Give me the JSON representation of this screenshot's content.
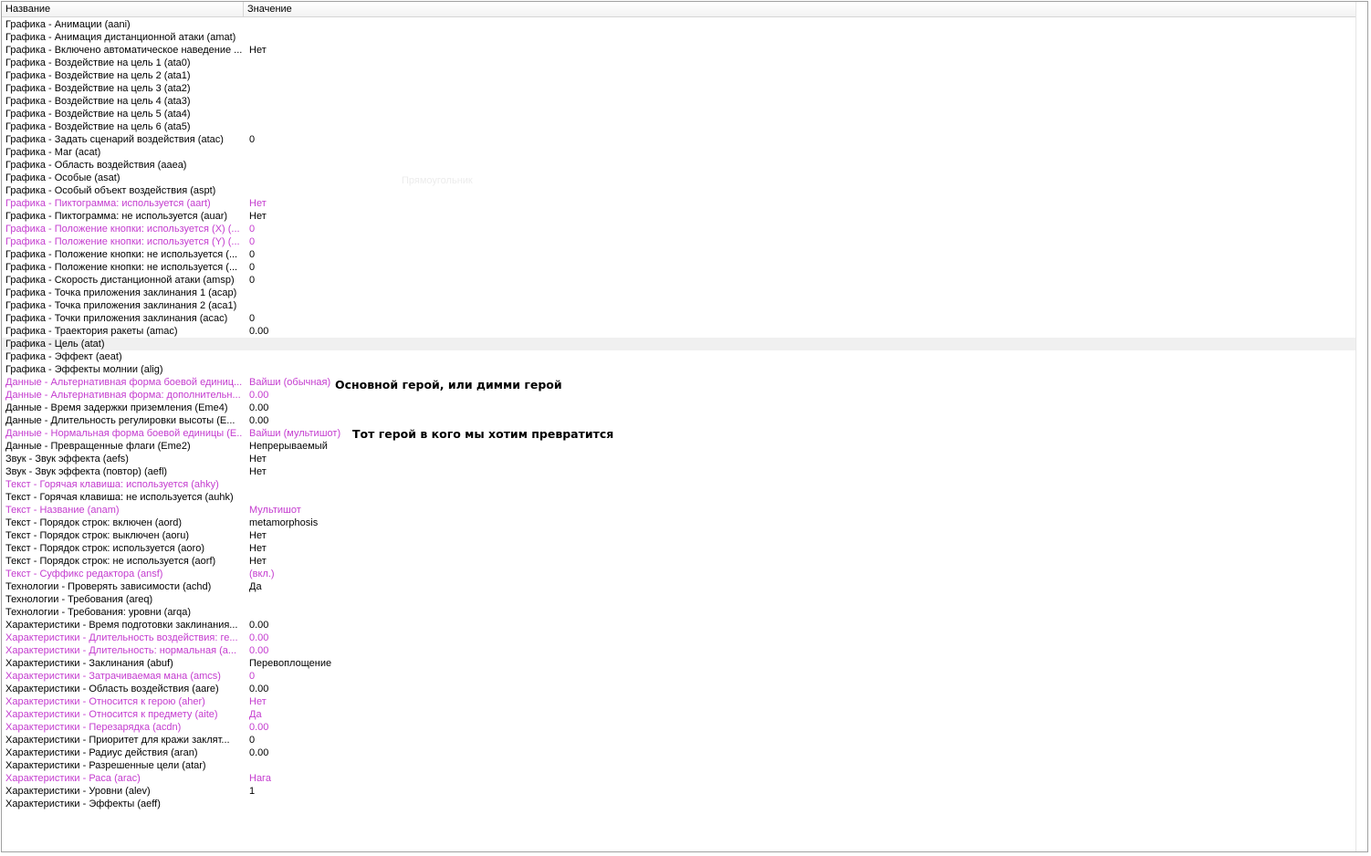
{
  "columns": {
    "name": "Название",
    "value": "Значение"
  },
  "rows": [
    {
      "name": "Графика - Анимации (aani)",
      "value": "",
      "modified": false
    },
    {
      "name": "Графика - Анимация дистанционной атаки (amat)",
      "value": "",
      "modified": false
    },
    {
      "name": "Графика - Включено автоматическое наведение ...",
      "value": "Нет",
      "modified": false
    },
    {
      "name": "Графика - Воздействие на цель 1 (ata0)",
      "value": "",
      "modified": false
    },
    {
      "name": "Графика - Воздействие на цель 2 (ata1)",
      "value": "",
      "modified": false
    },
    {
      "name": "Графика - Воздействие на цель 3 (ata2)",
      "value": "",
      "modified": false
    },
    {
      "name": "Графика - Воздействие на цель 4 (ata3)",
      "value": "",
      "modified": false
    },
    {
      "name": "Графика - Воздействие на цель 5 (ata4)",
      "value": "",
      "modified": false
    },
    {
      "name": "Графика - Воздействие на цель 6 (ata5)",
      "value": "",
      "modified": false
    },
    {
      "name": "Графика - Задать сценарий воздействия (atac)",
      "value": "0",
      "modified": false
    },
    {
      "name": "Графика - Маг (acat)",
      "value": "",
      "modified": false
    },
    {
      "name": "Графика - Область воздействия (aaea)",
      "value": "",
      "modified": false
    },
    {
      "name": "Графика - Особые (asat)",
      "value": "",
      "modified": false
    },
    {
      "name": "Графика - Особый объект воздействия (aspt)",
      "value": "",
      "modified": false
    },
    {
      "name": "Графика - Пиктограмма: используется (aart)",
      "value": "Нет",
      "modified": true
    },
    {
      "name": "Графика - Пиктограмма: не используется (auar)",
      "value": "Нет",
      "modified": false
    },
    {
      "name": "Графика - Положение кнопки: используется (X) (...",
      "value": "0",
      "modified": true
    },
    {
      "name": "Графика - Положение кнопки: используется (Y) (...",
      "value": "0",
      "modified": true
    },
    {
      "name": "Графика - Положение кнопки: не используется (...",
      "value": "0",
      "modified": false
    },
    {
      "name": "Графика - Положение кнопки: не используется (...",
      "value": "0",
      "modified": false
    },
    {
      "name": "Графика - Скорость дистанционной атаки (amsp)",
      "value": "0",
      "modified": false
    },
    {
      "name": "Графика - Точка приложения заклинания 1 (acap)",
      "value": "",
      "modified": false
    },
    {
      "name": "Графика - Точка приложения заклинания 2 (aca1)",
      "value": "",
      "modified": false
    },
    {
      "name": "Графика - Точки приложения заклинания (acac)",
      "value": "0",
      "modified": false
    },
    {
      "name": "Графика - Траектория ракеты (amac)",
      "value": "0.00",
      "modified": false
    },
    {
      "name": "Графика - Цель (atat)",
      "value": "",
      "modified": false
    },
    {
      "name": "Графика - Эффект (aeat)",
      "value": "",
      "modified": false
    },
    {
      "name": "Графика - Эффекты молнии (alig)",
      "value": "",
      "modified": false
    },
    {
      "name": "Данные - Альтернативная форма боевой единиц...",
      "value": "Вайши (обычная)",
      "modified": true
    },
    {
      "name": "Данные - Альтернативная форма: дополнительн...",
      "value": "0.00",
      "modified": true
    },
    {
      "name": "Данные - Время задержки приземления (Eme4)",
      "value": "0.00",
      "modified": false
    },
    {
      "name": "Данные - Длительность регулировки высоты (E...",
      "value": "0.00",
      "modified": false
    },
    {
      "name": "Данные - Нормальная форма боевой единицы (E...",
      "value": "Вайши (мультишот)",
      "modified": true
    },
    {
      "name": "Данные - Превращенные флаги (Eme2)",
      "value": "Непрерываемый",
      "modified": false
    },
    {
      "name": "Звук - Звук эффекта (aefs)",
      "value": "Нет",
      "modified": false
    },
    {
      "name": "Звук - Звук эффекта (повтор) (aefl)",
      "value": "Нет",
      "modified": false
    },
    {
      "name": "Текст - Горячая клавиша: используется (ahky)",
      "value": "",
      "modified": true
    },
    {
      "name": "Текст - Горячая клавиша: не используется (auhk)",
      "value": "",
      "modified": false
    },
    {
      "name": "Текст - Название (anam)",
      "value": "Мультишот",
      "modified": true
    },
    {
      "name": "Текст - Порядок строк: включен (aord)",
      "value": "metamorphosis",
      "modified": false
    },
    {
      "name": "Текст - Порядок строк: выключен (aoru)",
      "value": "Нет",
      "modified": false
    },
    {
      "name": "Текст - Порядок строк: используется (aoro)",
      "value": "Нет",
      "modified": false
    },
    {
      "name": "Текст - Порядок строк: не используется (aorf)",
      "value": "Нет",
      "modified": false
    },
    {
      "name": "Текст - Суффикс редактора (ansf)",
      "value": " (вкл.)",
      "modified": true
    },
    {
      "name": "Технологии - Проверять зависимости (achd)",
      "value": "Да",
      "modified": false
    },
    {
      "name": "Технологии - Требования (areq)",
      "value": "",
      "modified": false
    },
    {
      "name": "Технологии - Требования: уровни (arqa)",
      "value": "",
      "modified": false
    },
    {
      "name": "Характеристики - Время подготовки заклинания...",
      "value": "0.00",
      "modified": false
    },
    {
      "name": "Характеристики - Длительность воздействия: ге...",
      "value": "0.00",
      "modified": true
    },
    {
      "name": "Характеристики - Длительность: нормальная (a...",
      "value": "0.00",
      "modified": true
    },
    {
      "name": "Характеристики - Заклинания (abuf)",
      "value": "Перевоплощение",
      "modified": false
    },
    {
      "name": "Характеристики - Затрачиваемая мана (amcs)",
      "value": "0",
      "modified": true
    },
    {
      "name": "Характеристики - Область воздействия (aare)",
      "value": "0.00",
      "modified": false
    },
    {
      "name": "Характеристики - Относится к герою (aher)",
      "value": "Нет",
      "modified": true
    },
    {
      "name": "Характеристики - Относится к предмету (aite)",
      "value": "Да",
      "modified": true
    },
    {
      "name": "Характеристики - Перезарядка (acdn)",
      "value": "0.00",
      "modified": true
    },
    {
      "name": "Характеристики - Приоритет для кражи заклят...",
      "value": "0",
      "modified": false
    },
    {
      "name": "Характеристики - Радиус действия (aran)",
      "value": "0.00",
      "modified": false
    },
    {
      "name": "Характеристики - Разрешенные цели (atar)",
      "value": "",
      "modified": false
    },
    {
      "name": "Характеристики - Раса (arac)",
      "value": "Нага",
      "modified": true
    },
    {
      "name": "Характеристики - Уровни (alev)",
      "value": "1",
      "modified": false
    },
    {
      "name": "Характеристики - Эффекты (aeff)",
      "value": "",
      "modified": false
    }
  ],
  "annotations": {
    "main_hero": "Основной герой, или димми герой",
    "target_hero": "Тот герой в кого мы хотим превратится"
  },
  "ghost_text": "Прямоугольник",
  "colors": {
    "modified": "#c43ccf",
    "highlight_row": "#f0f0f0",
    "border": "#a0a0a0"
  }
}
